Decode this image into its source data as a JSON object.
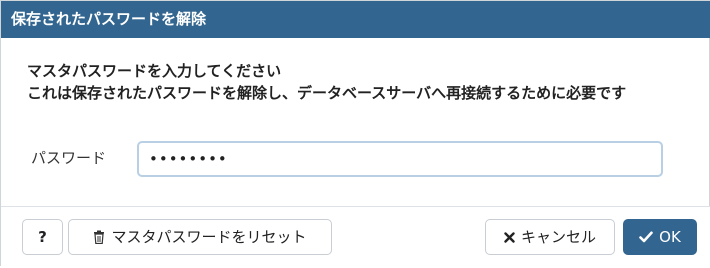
{
  "dialog": {
    "title": "保存されたパスワードを解除",
    "message_line1": "マスタパスワードを入力してください",
    "message_line2": "これは保存されたパスワードを解除し、データベースサーバへ再接続するために必要です",
    "password_label": "パスワード",
    "password_value": "********"
  },
  "buttons": {
    "help_label": "?",
    "reset_label": "マスタパスワードをリセット",
    "cancel_label": "キャンセル",
    "ok_label": "OK"
  },
  "icons": {
    "reset": "trash-icon",
    "cancel": "x-icon",
    "ok": "check-icon"
  },
  "colors": {
    "primary": "#326690",
    "input_border": "#b9cfe4"
  }
}
